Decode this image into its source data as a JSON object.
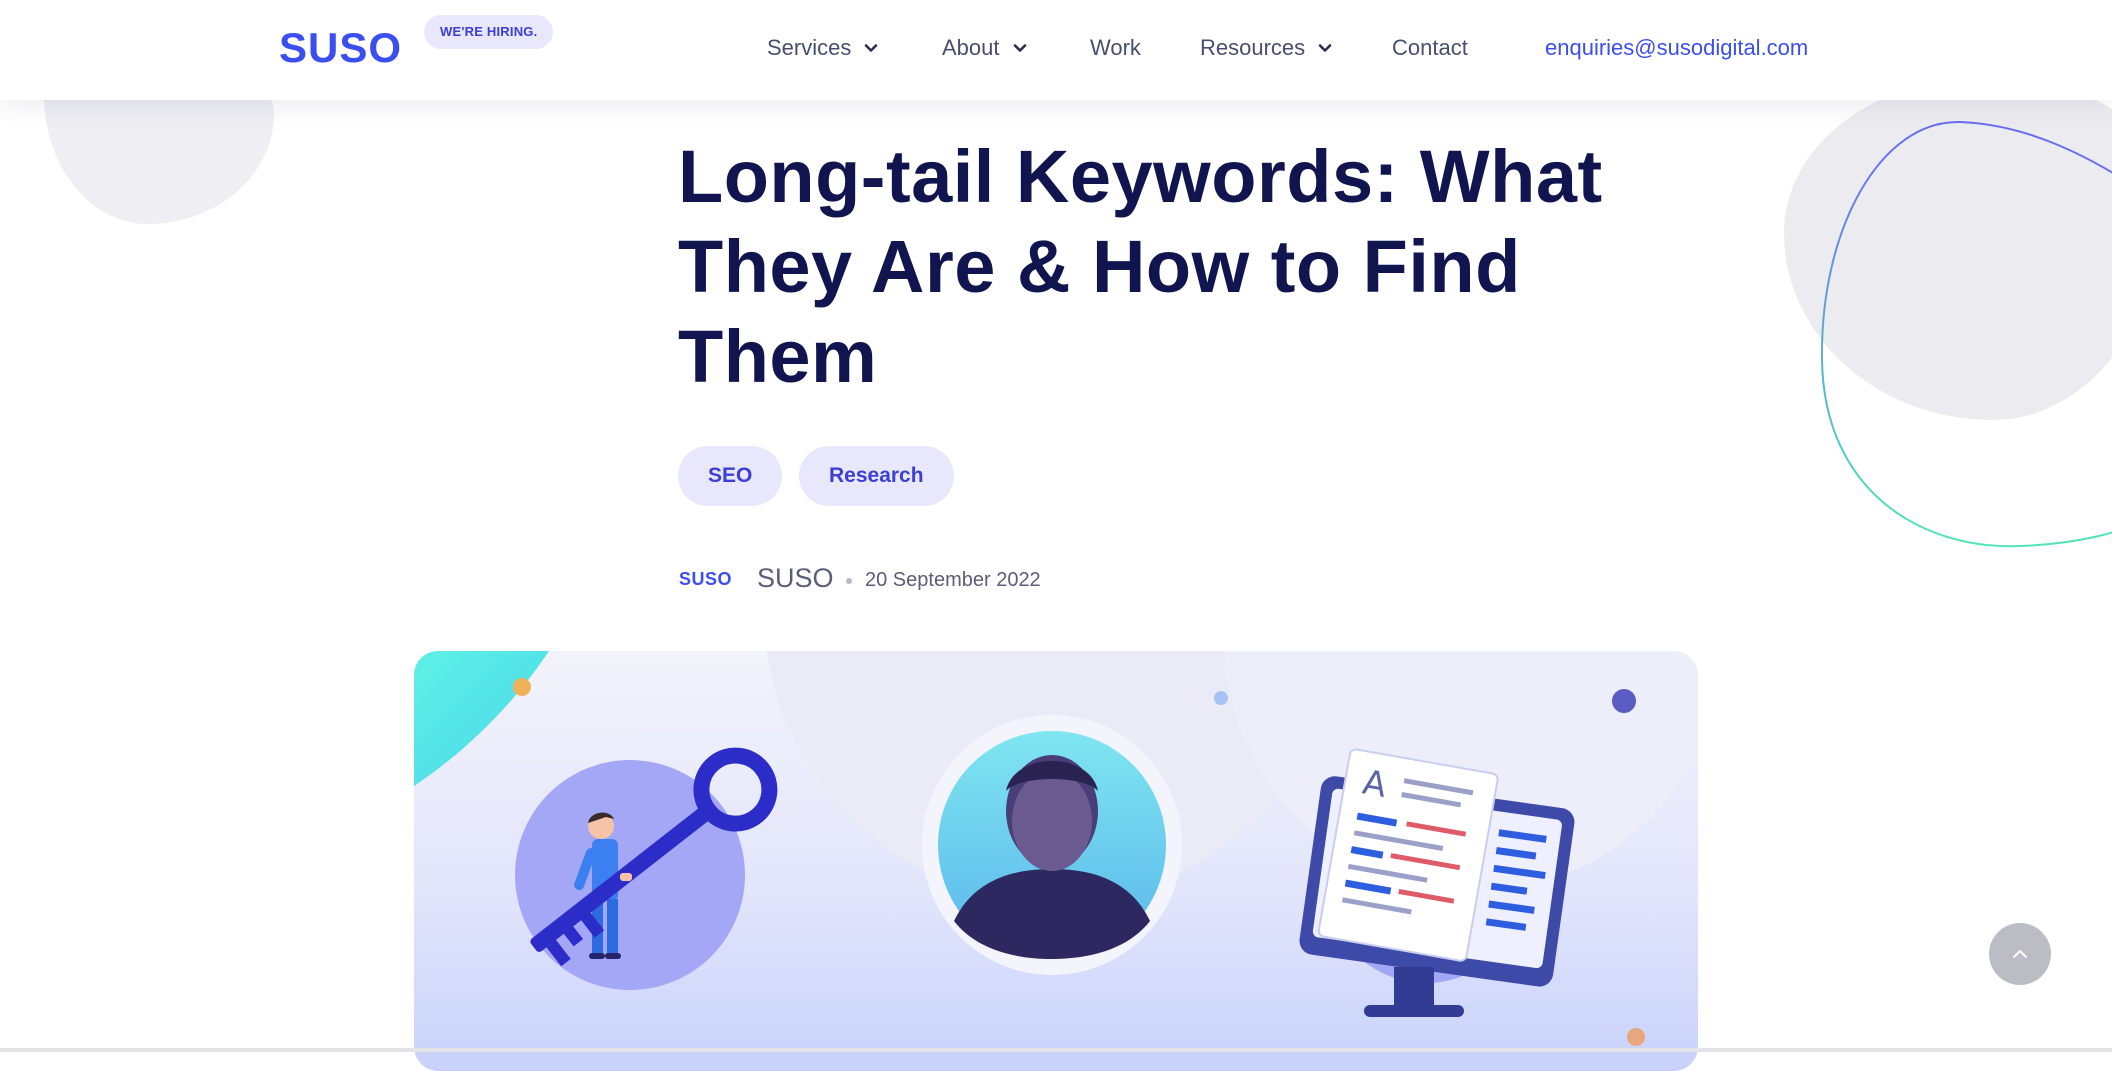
{
  "header": {
    "logo": "SUSO",
    "hiring_badge": "WE'RE HIRING.",
    "nav": [
      {
        "label": "Services",
        "dropdown": true
      },
      {
        "label": "About",
        "dropdown": true
      },
      {
        "label": "Work",
        "dropdown": false
      },
      {
        "label": "Resources",
        "dropdown": true
      },
      {
        "label": "Contact",
        "dropdown": false
      }
    ],
    "email": "enquiries@susodigital.com"
  },
  "article": {
    "title": "Long-tail Keywords: What They Are & How to Find Them",
    "tags": [
      "SEO",
      "Research"
    ],
    "author_logo": "SUSO",
    "author": "SUSO",
    "date": "20 September 2022"
  },
  "hero_icons": [
    "person-with-key-illustration",
    "author-portrait",
    "monitor-with-document-illustration"
  ],
  "scroll_top_icon": "chevron-up-icon",
  "colors": {
    "brand_blue": "#3b4ef0",
    "title_navy": "#10144f",
    "tag_bg": "#e8e7fb",
    "tag_text": "#3b3fd6"
  }
}
